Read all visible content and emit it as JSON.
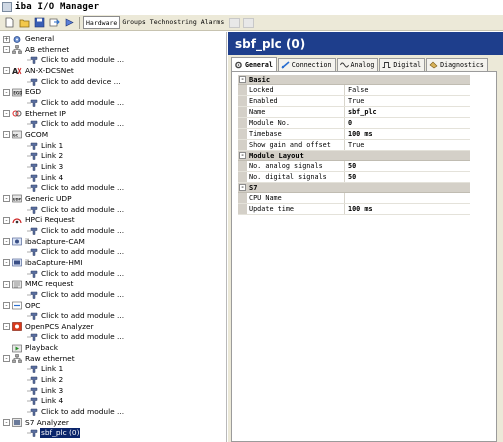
{
  "app": {
    "title": "iba I/O Manager"
  },
  "toolbar": {
    "buttons": [
      "new-icon",
      "open-icon",
      "save-icon",
      "import-icon",
      "export-icon"
    ],
    "tabs": [
      "Hardware",
      "Groups",
      "Technostring",
      "Alarms"
    ],
    "active_tab": "Hardware"
  },
  "tree": {
    "items": [
      {
        "label": "General",
        "icon": "gear-icon",
        "level": 0,
        "expander": "+"
      },
      {
        "label": "AB ethernet",
        "icon": "network-icon",
        "level": 0,
        "expander": "-"
      },
      {
        "label": "Click to add module ...",
        "level": 1
      },
      {
        "label": "AN-X-DCSNet",
        "icon": "anx-icon",
        "level": 0,
        "expander": "-"
      },
      {
        "label": "Click to add device ...",
        "level": 1
      },
      {
        "label": "EGD",
        "icon": "egd-icon",
        "level": 0,
        "expander": "-"
      },
      {
        "label": "Click to add module ...",
        "level": 1
      },
      {
        "label": "Ethernet IP",
        "icon": "ethernet-ip-icon",
        "level": 0,
        "expander": "-"
      },
      {
        "label": "Click to add module ...",
        "level": 1
      },
      {
        "label": "GCOM",
        "icon": "gcom-icon",
        "level": 0,
        "expander": "-"
      },
      {
        "label": "Link 1",
        "level": 1
      },
      {
        "label": "Link 2",
        "level": 1
      },
      {
        "label": "Link 3",
        "level": 1
      },
      {
        "label": "Link 4",
        "level": 1
      },
      {
        "label": "Click to add module ...",
        "level": 1
      },
      {
        "label": "Generic UDP",
        "icon": "udp-icon",
        "level": 0,
        "expander": "-"
      },
      {
        "label": "Click to add module ...",
        "level": 1
      },
      {
        "label": "HPCi Request",
        "icon": "hpci-icon",
        "level": 0,
        "expander": "-"
      },
      {
        "label": "Click to add module ...",
        "level": 1
      },
      {
        "label": "ibaCapture-CAM",
        "icon": "capture-cam-icon",
        "level": 0,
        "expander": "-"
      },
      {
        "label": "Click to add module ...",
        "level": 1
      },
      {
        "label": "ibaCapture-HMI",
        "icon": "capture-hmi-icon",
        "level": 0,
        "expander": "-"
      },
      {
        "label": "Click to add module ...",
        "level": 1
      },
      {
        "label": "MMC request",
        "icon": "mmc-icon",
        "level": 0,
        "expander": "-"
      },
      {
        "label": "Click to add module ...",
        "level": 1
      },
      {
        "label": "OPC",
        "icon": "opc-icon",
        "level": 0,
        "expander": "-"
      },
      {
        "label": "Click to add module ...",
        "level": 1
      },
      {
        "label": "OpenPCS Analyzer",
        "icon": "openpcs-icon",
        "level": 0,
        "expander": "-"
      },
      {
        "label": "Click to add module ...",
        "level": 1
      },
      {
        "label": "Playback",
        "icon": "playback-icon",
        "level": 0,
        "expander": ""
      },
      {
        "label": "Raw ethernet",
        "icon": "raw-ethernet-icon",
        "level": 0,
        "expander": "-"
      },
      {
        "label": "Link 1",
        "level": 1
      },
      {
        "label": "Link 2",
        "level": 1
      },
      {
        "label": "Link 3",
        "level": 1
      },
      {
        "label": "Link 4",
        "level": 1
      },
      {
        "label": "Click to add module ...",
        "level": 1
      },
      {
        "label": "S7 Analyzer",
        "icon": "s7-icon",
        "level": 0,
        "expander": "-"
      },
      {
        "label": "sbf_plc (0)",
        "level": 1,
        "selected": true
      }
    ]
  },
  "panel": {
    "title": "sbf_plc (0)",
    "tabs": [
      {
        "label": "General",
        "icon": "gear-icon",
        "active": true
      },
      {
        "label": "Connection",
        "icon": "connection-icon"
      },
      {
        "label": "Analog",
        "icon": "analog-icon"
      },
      {
        "label": "Digital",
        "icon": "digital-icon"
      },
      {
        "label": "Diagnostics",
        "icon": "diagnostics-icon"
      }
    ],
    "sections": [
      {
        "name": "Basic",
        "rows": [
          {
            "name": "Locked",
            "value": "False"
          },
          {
            "name": "Enabled",
            "value": "True"
          },
          {
            "name": "Name",
            "value": "sbf_plc",
            "bold": true
          },
          {
            "name": "Module No.",
            "value": "0",
            "bold": true
          },
          {
            "name": "Timebase",
            "value": "100 ms",
            "bold": true
          },
          {
            "name": "Show gain and offset",
            "value": "True"
          }
        ]
      },
      {
        "name": "Module Layout",
        "rows": [
          {
            "name": "No. analog signals",
            "value": "50",
            "bold": true
          },
          {
            "name": "No. digital signals",
            "value": "50",
            "bold": true
          }
        ]
      },
      {
        "name": "S7",
        "rows": [
          {
            "name": "CPU Name",
            "value": ""
          },
          {
            "name": "Update time",
            "value": "100 ms",
            "bold": true
          }
        ]
      }
    ]
  }
}
